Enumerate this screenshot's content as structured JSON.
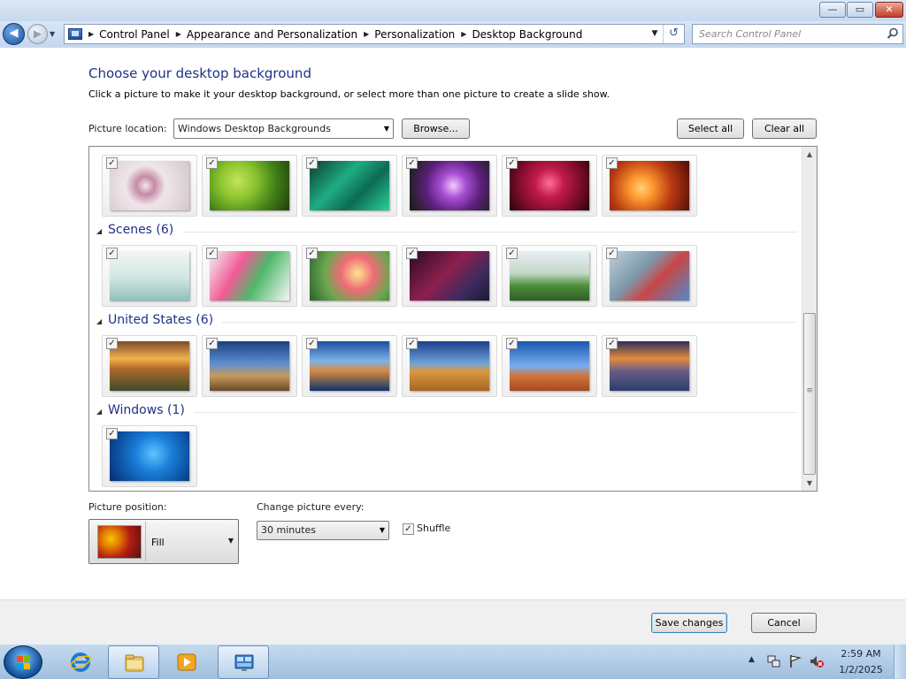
{
  "window": {
    "min_label": "—",
    "max_label": "▭",
    "close_label": "✕"
  },
  "nav": {
    "breadcrumb": [
      "Control Panel",
      "Appearance and Personalization",
      "Personalization",
      "Desktop Background"
    ],
    "search_placeholder": "Search Control Panel"
  },
  "content": {
    "title": "Choose your desktop background",
    "description": "Click a picture to make it your desktop background, or select more than one picture to create a slide show.",
    "location_label": "Picture location:",
    "location_value": "Windows Desktop Backgrounds",
    "browse_label": "Browse...",
    "select_all_label": "Select all",
    "clear_all_label": "Clear all"
  },
  "gallery": {
    "groups": [
      {
        "label": "",
        "checked": [
          true,
          true,
          true,
          true,
          true,
          true
        ],
        "images": [
          "flower-white-spikes",
          "green-succulent",
          "teal-leaves",
          "purple-thistle",
          "red-dahlia",
          "orange-flowers"
        ]
      },
      {
        "label": "Scenes (6)",
        "checked": [
          true,
          true,
          true,
          true,
          true,
          true
        ],
        "images": [
          "scene-floating-islands",
          "scene-tree-creatures",
          "scene-mushrooms",
          "scene-dark-forest",
          "scene-field-path",
          "scene-balloons"
        ]
      },
      {
        "label": "United States (6)",
        "checked": [
          true,
          true,
          true,
          true,
          true,
          true
        ],
        "images": [
          "us-sunset-marsh",
          "us-lighthouse",
          "us-rock-arch-water",
          "us-hay-bale",
          "us-delicate-arch",
          "us-lake-sunset"
        ]
      },
      {
        "label": "Windows (1)",
        "checked": [
          true
        ],
        "images": [
          "windows-logo-blue"
        ]
      }
    ],
    "scrollbar_grip": "≡"
  },
  "options": {
    "position_label": "Picture position:",
    "position_value": "Fill",
    "interval_label": "Change picture every:",
    "interval_value": "30 minutes",
    "shuffle_label": "Shuffle",
    "shuffle_checked": true
  },
  "footer": {
    "save_label": "Save changes",
    "cancel_label": "Cancel"
  },
  "taskbar": {
    "apps": [
      "internet-explorer",
      "windows-explorer",
      "media-player",
      "control-panel"
    ],
    "clock_time": "2:59 AM",
    "clock_date": "1/2/2025"
  }
}
